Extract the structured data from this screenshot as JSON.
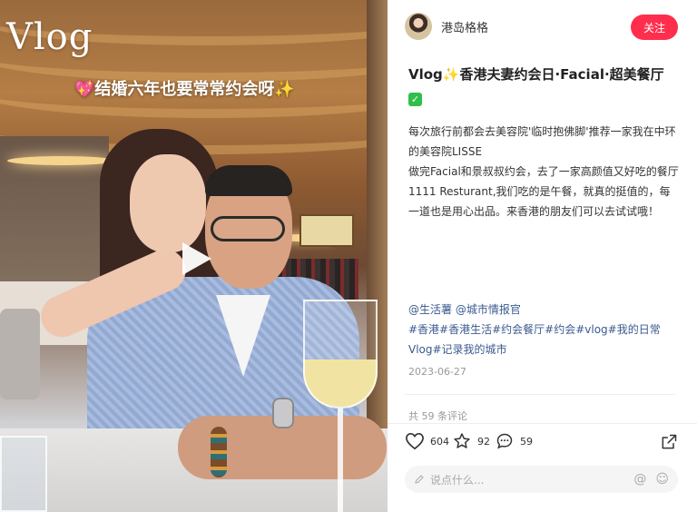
{
  "media": {
    "overlay_title": "Vlog",
    "overlay_caption": "💖结婚六年也要常常约会呀✨"
  },
  "author": {
    "name": "港岛格格",
    "follow_label": "关注"
  },
  "post": {
    "title": "Vlog✨香港夫妻约会日·Facial·超美餐厅",
    "title_badge": "✓",
    "body": [
      "每次旅行前都会去美容院'临时抱佛脚'推荐一家我在中环的美容院LISSE",
      "做完Facial和景叔叔约会，去了一家高颜值又好吃的餐厅 1111 Resturant,我们吃的是午餐，就真的挺值的，每一道也是用心出品。来香港的朋友们可以去试试哦！"
    ],
    "mentions": "@生活薯 @城市情报官",
    "hashtags": "#香港#香港生活#约会餐厅#约会#vlog#我的日常Vlog#记录我的城市",
    "date": "2023-06-27",
    "comment_count_text": "共 59 条评论"
  },
  "actions": {
    "likes": "604",
    "collects": "92",
    "comments": "59"
  },
  "comment_box": {
    "placeholder": "说点什么..."
  }
}
